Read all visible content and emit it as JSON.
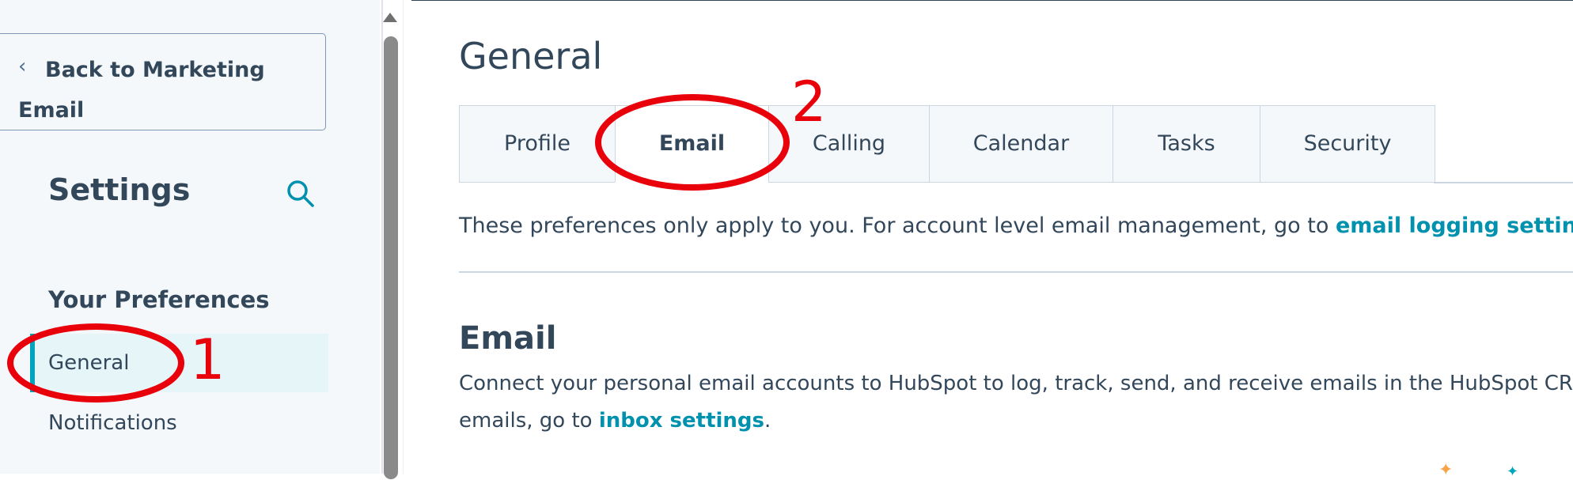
{
  "sidebar": {
    "back_label": "Back to Marketing Email",
    "title": "Settings",
    "section_heading": "Your Preferences",
    "items": [
      {
        "label": "General",
        "active": true
      },
      {
        "label": "Notifications",
        "active": false
      }
    ]
  },
  "main": {
    "title": "General",
    "tabs": [
      {
        "label": "Profile"
      },
      {
        "label": "Email",
        "active": true
      },
      {
        "label": "Calling"
      },
      {
        "label": "Calendar"
      },
      {
        "label": "Tasks"
      },
      {
        "label": "Security"
      }
    ],
    "intro_text": "These preferences only apply to you. For account level email management, go to ",
    "intro_link": "email logging settings",
    "intro_end": ".",
    "section": {
      "title": "Email",
      "desc_line1": "Connect your personal email accounts to HubSpot to log, track, send, and receive emails in the HubSpot CR",
      "desc_line2_start": "emails, go to ",
      "desc_link": "inbox settings",
      "desc_line2_end": "."
    }
  },
  "annotations": {
    "marker_1": "1",
    "marker_2": "2",
    "color": "#e8000b"
  },
  "colors": {
    "accent": "#00a4bd",
    "link": "#0091ae",
    "text": "#33475b",
    "sidebar_bg": "#f5f8fa"
  }
}
